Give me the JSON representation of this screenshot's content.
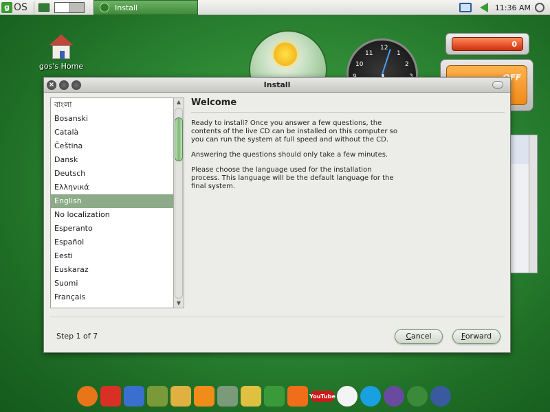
{
  "top_panel": {
    "logo_g": "g",
    "logo_os": "OS",
    "taskbar_item": "Install",
    "clock": "11:36 AM"
  },
  "desktop": {
    "home_label": "gos's Home",
    "battery_value": "0",
    "switch_label": "OFF",
    "clock_numbers": [
      "12",
      "1",
      "2",
      "3",
      "11",
      "10",
      "9"
    ]
  },
  "install_window": {
    "title": "Install",
    "languages": [
      "বাংলা",
      "Bosanski",
      "Català",
      "Čeština",
      "Dansk",
      "Deutsch",
      "Ελληνικά",
      "English",
      "No localization",
      "Esperanto",
      "Español",
      "Eesti",
      "Euskaraz",
      "Suomi",
      "Français"
    ],
    "selected_language": "English",
    "heading": "Welcome",
    "paragraphs": [
      "Ready to install? Once you answer a few questions, the contents of the live CD can be installed on this computer so you can run the system at full speed and without the CD.",
      "Answering the questions should only take a few minutes.",
      "Please choose the language used for the installation process. This language will be the default language for the final system."
    ],
    "step": "Step 1 of 7",
    "cancel_button": "Cancel",
    "forward_button": "Forward"
  },
  "dock": {
    "icons": [
      {
        "name": "firefox-icon",
        "color": "#e8751a"
      },
      {
        "name": "gmail-icon",
        "color": "#d93025"
      },
      {
        "name": "calendar-icon",
        "color": "#3a6fd0"
      },
      {
        "name": "spreadsheet-icon",
        "color": "#7a9a3a"
      },
      {
        "name": "notes-icon",
        "color": "#e0b040"
      },
      {
        "name": "rss-icon",
        "color": "#f08c1a"
      },
      {
        "name": "news-icon",
        "color": "#7a9a7a"
      },
      {
        "name": "shopping-bag-icon",
        "color": "#e0c040"
      },
      {
        "name": "photo-icon",
        "color": "#3a9a3a"
      },
      {
        "name": "blogger-icon",
        "color": "#f06d1a"
      },
      {
        "name": "youtube-icon",
        "color": "#cc1a1a"
      },
      {
        "name": "chat-icon",
        "color": "#f4f4f4"
      },
      {
        "name": "skype-icon",
        "color": "#18a0e0"
      },
      {
        "name": "openoffice-writer-icon",
        "color": "#6a4aa0"
      },
      {
        "name": "openoffice-calc-icon",
        "color": "#3a8a3a"
      },
      {
        "name": "openoffice-impress-icon",
        "color": "#3a5aa0"
      }
    ],
    "youtube_label": "YouTube"
  }
}
